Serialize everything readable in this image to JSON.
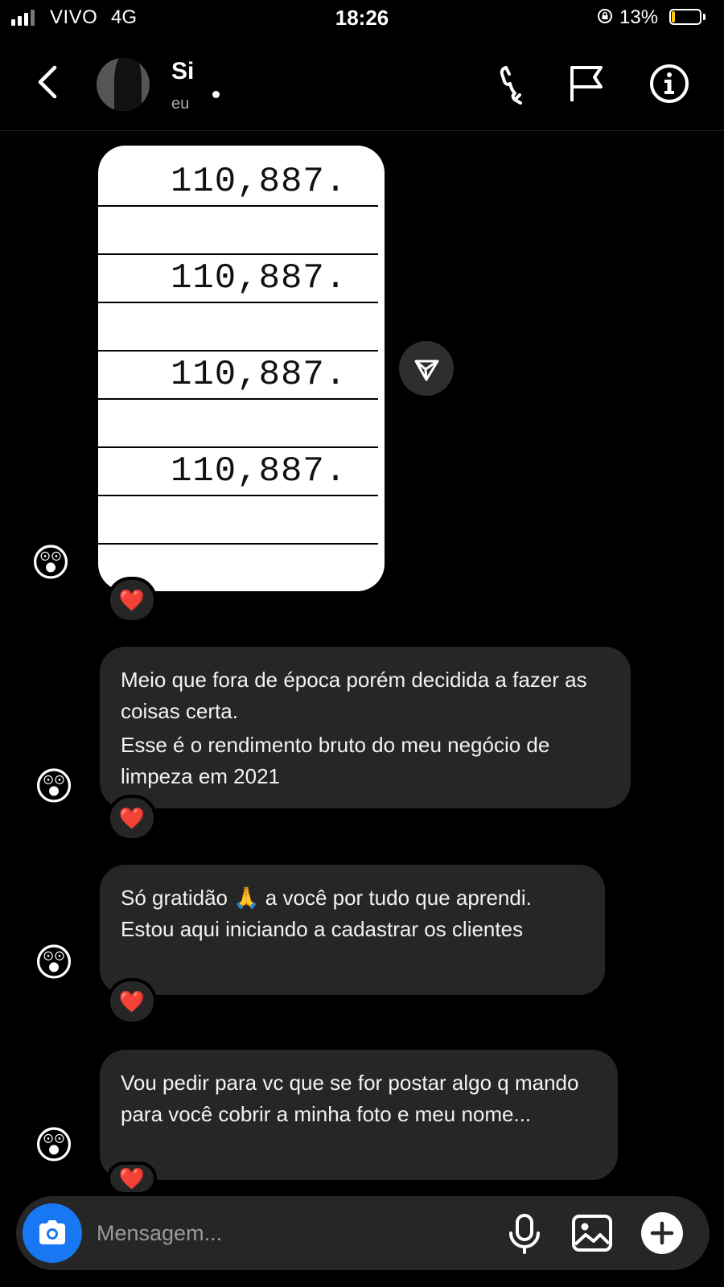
{
  "status_bar": {
    "carrier": "VIVO",
    "network": "4G",
    "time": "18:26",
    "battery_percent": "13%",
    "battery_level": 0.13,
    "battery_color": "#ffcc00"
  },
  "header": {
    "contact_name": "Si",
    "contact_subtitle": "eu",
    "icons": [
      "back-icon",
      "phone-icon",
      "flag-icon",
      "info-icon"
    ]
  },
  "image_message": {
    "lines": [
      "110,887.",
      "110,887.",
      "110,887.",
      "110,887."
    ],
    "reaction": "❤️"
  },
  "messages": [
    {
      "paragraphs": [
        "Meio que fora de época porém decidida a fazer as coisas certa.",
        "Esse é o rendimento bruto do meu negócio de limpeza em 2021"
      ],
      "avatar": "😲",
      "reaction": "❤️"
    },
    {
      "paragraphs": [
        "Só gratidão 🙏 a você por tudo que aprendi. Estou aqui iniciando a cadastrar os clientes"
      ],
      "avatar": "😲",
      "reaction": "❤️"
    },
    {
      "paragraphs": [
        "Vou pedir para vc que se for postar algo q mando para você cobrir a minha foto e meu nome..."
      ],
      "avatar": "😲",
      "reaction": "❤️"
    }
  ],
  "image_message_avatar": "😲",
  "composer": {
    "placeholder": "Mensagem...",
    "accent": "#1877f2"
  }
}
